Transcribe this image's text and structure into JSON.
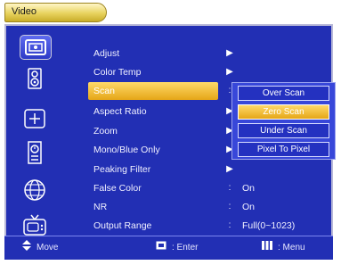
{
  "title": "Video",
  "side_icons": [
    {
      "name": "picture-icon",
      "active": true
    },
    {
      "name": "speaker-icon",
      "active": false
    },
    {
      "name": "crosshair-icon",
      "active": false
    },
    {
      "name": "timer-icon",
      "active": false
    },
    {
      "name": "globe-icon",
      "active": false
    },
    {
      "name": "tv-icon",
      "active": false
    }
  ],
  "menu": [
    {
      "label": "Adjust",
      "mark": "▶",
      "value": ""
    },
    {
      "label": "Color Temp",
      "mark": "▶",
      "value": ""
    },
    {
      "label": "Scan",
      "mark": ":",
      "value": "",
      "selected": true
    },
    {
      "label": "Aspect Ratio",
      "mark": "▶",
      "value": ""
    },
    {
      "label": "Zoom",
      "mark": "▶",
      "value": ""
    },
    {
      "label": "Mono/Blue Only",
      "mark": "▶",
      "value": ""
    },
    {
      "label": "Peaking Filter",
      "mark": "▶",
      "value": ""
    },
    {
      "label": "False Color",
      "mark": ":",
      "value": "On"
    },
    {
      "label": "NR",
      "mark": ":",
      "value": "On"
    },
    {
      "label": "Output Range",
      "mark": ":",
      "value": "Full(0~1023)"
    }
  ],
  "submenu": [
    {
      "label": "Over Scan",
      "selected": false
    },
    {
      "label": "Zero Scan",
      "selected": true
    },
    {
      "label": "Under Scan",
      "selected": false
    },
    {
      "label": "Pixel To Pixel",
      "selected": false
    }
  ],
  "footer": {
    "move": "Move",
    "enter": ": Enter",
    "menu": ": Menu"
  }
}
